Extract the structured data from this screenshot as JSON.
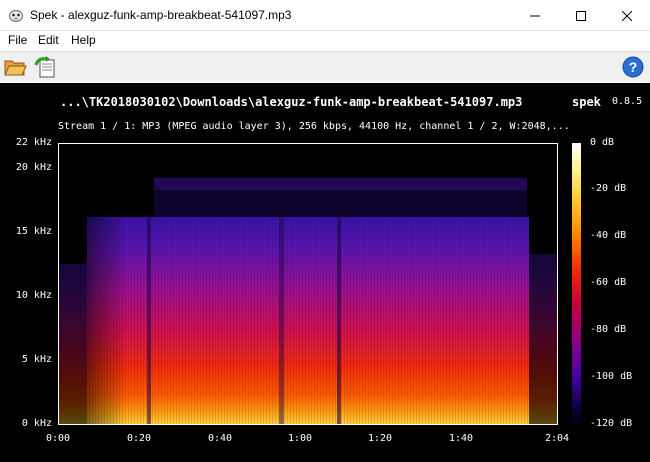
{
  "window": {
    "title": "Spek - alexguz-funk-amp-breakbeat-541097.mp3"
  },
  "menu": {
    "items": [
      {
        "label": "File"
      },
      {
        "label": "Edit"
      },
      {
        "label": "Help"
      }
    ]
  },
  "toolbar": {
    "buttons": [
      {
        "icon": "folder-open-icon"
      },
      {
        "icon": "save-export-icon"
      },
      {
        "icon": "help-icon"
      }
    ]
  },
  "spectrogram": {
    "file_title": "...\\TK2018030102\\Downloads\\alexguz-funk-amp-breakbeat-541097.mp3",
    "app_name": "spek",
    "app_version": "0.8.5",
    "stream_info": "Stream 1 / 1: MP3 (MPEG audio layer 3), 256 kbps, 44100 Hz, channel 1 / 2, W:2048,...",
    "freq_axis": [
      "22 kHz",
      "20 kHz",
      "15 kHz",
      "10 kHz",
      "5 kHz",
      "0 kHz"
    ],
    "time_axis": [
      "0:00",
      "0:20",
      "0:40",
      "1:00",
      "1:20",
      "1:40",
      "2:04"
    ],
    "db_scale": [
      "0 dB",
      "-20 dB",
      "-40 dB",
      "-60 dB",
      "-80 dB",
      "-100 dB",
      "-120 dB"
    ],
    "colors": {
      "background": "#000000",
      "cutoff_band": "#3b0fa0",
      "low_energy": "#ff3a00",
      "high_energy": "#ffd040"
    }
  }
}
